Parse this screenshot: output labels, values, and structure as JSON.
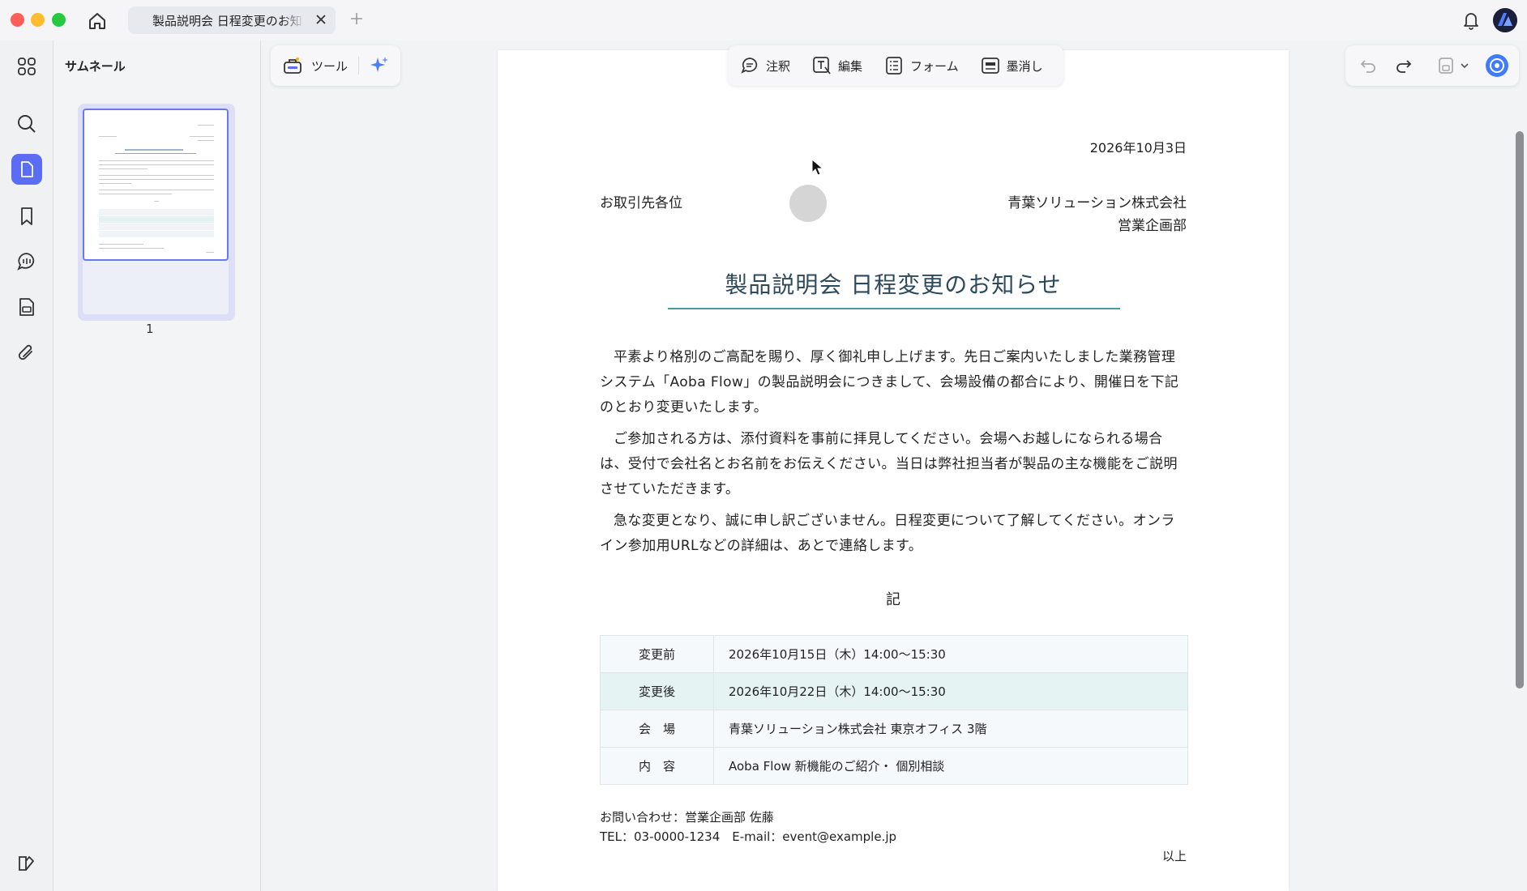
{
  "window": {
    "tab_title": "製品説明会 日程変更のお知らせ",
    "tab_add": "+"
  },
  "sidebar": {
    "panel_title": "サムネール",
    "items": [
      {
        "icon": "grid-icon"
      },
      {
        "icon": "search-icon"
      },
      {
        "icon": "page-icon",
        "active": true
      },
      {
        "icon": "bookmark-icon"
      },
      {
        "icon": "comment-icon"
      },
      {
        "icon": "document-icon"
      },
      {
        "icon": "attachment-icon"
      },
      {
        "icon": "theme-icon"
      }
    ],
    "thumbnail_page_number": "1"
  },
  "toolbar": {
    "tools_label": "ツール",
    "annotate_label": "注釈",
    "edit_label": "編集",
    "form_label": "フォーム",
    "redact_label": "墨消し"
  },
  "document": {
    "date": "2026年10月3日",
    "addressee": "お取引先各位",
    "sender_company": "青葉ソリューション株式会社",
    "sender_department": "営業企画部",
    "title": "製品説明会 日程変更のお知らせ",
    "paragraphs": [
      "平素より格別のご高配を賜り、厚く御礼申し上げます。先日ご案内いたしました業務管理システム「Aoba Flow」の製品説明会につきまして、会場設備の都合により、開催日を下記のとおり変更いたします。",
      "ご参加される方は、添付資料を事前に拝見してください。会場へお越しになられる場合は、受付で会社名とお名前をお伝えください。当日は弊社担当者が製品の主な機能をご説明させていただきます。",
      "急な変更となり、誠に申し訳ございません。日程変更について了解してください。オンライン参加用URLなどの詳細は、あとで連絡します。"
    ],
    "ki": "記",
    "table": [
      {
        "key": "変更前",
        "value": "2026年10月15日（木）14:00～15:30"
      },
      {
        "key": "変更後",
        "value": "2026年10月22日（木）14:00～15:30"
      },
      {
        "key": "会　場",
        "value": "青葉ソリューション株式会社 東京オフィス 3階"
      },
      {
        "key": "内　容",
        "value": "Aoba Flow 新機能のご紹介・ 個別相談"
      }
    ],
    "contact_line1": "お問い合わせ：営業企画部 佐藤",
    "contact_line2": "TEL：03-0000-1234　E-mail：event@example.jp",
    "closing": "以上"
  },
  "colors": {
    "accent": "#5b6cf5",
    "title_text": "#2d4a5c",
    "title_rule": "#4a9aa3",
    "highlight_row": "#e6f3f3"
  }
}
